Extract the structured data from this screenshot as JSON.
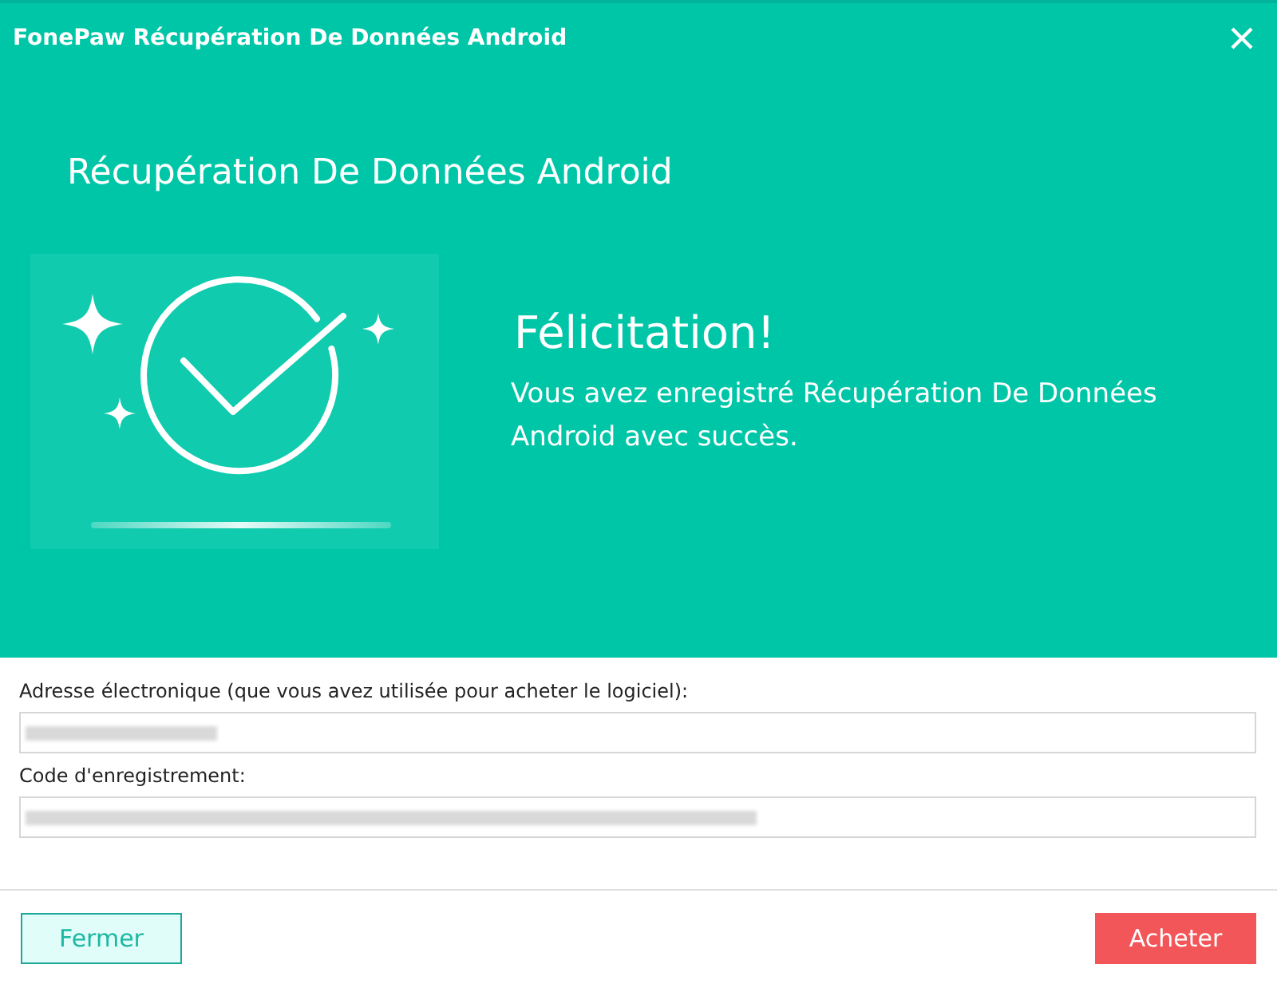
{
  "window": {
    "title": "FonePaw Récupération De Données Android"
  },
  "banner": {
    "product": "Récupération De Données Android",
    "heading": "Félicitation!",
    "message": "Vous avez enregistré Récupération De Données Android avec succès."
  },
  "fields": [
    {
      "label": "Adresse électronique (que vous avez utilisée pour acheter le logiciel):",
      "kind": "email",
      "redacted": true
    },
    {
      "label": "Code d'enregistrement:",
      "kind": "code",
      "redacted": true
    }
  ],
  "buttons": [
    {
      "label": "Fermer",
      "kind": "secondary"
    },
    {
      "label": "Acheter",
      "kind": "primary"
    }
  ]
}
